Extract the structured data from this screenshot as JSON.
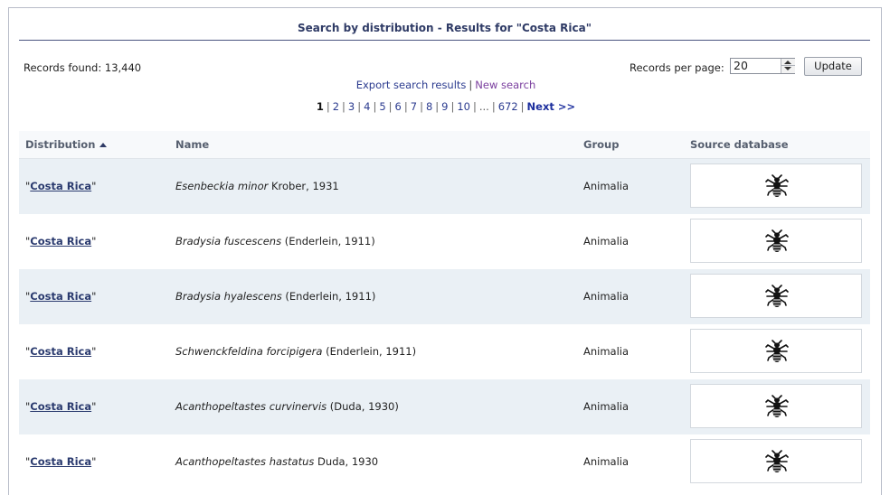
{
  "header": {
    "title": "Search by distribution - Results for \"Costa Rica\""
  },
  "toolbar": {
    "records_found": "Records found: 13,440",
    "records_per_page_label": "Records per page:",
    "records_per_page_value": "20",
    "update_label": "Update",
    "export_label": "Export search results",
    "separator": "|",
    "new_search_label": "New search"
  },
  "pagination": {
    "current": "1",
    "pages": [
      "2",
      "3",
      "4",
      "5",
      "6",
      "7",
      "8",
      "9",
      "10"
    ],
    "ellipsis": "...",
    "last": "672",
    "next_label": "Next >>"
  },
  "table": {
    "columns": {
      "distribution": "Distribution",
      "name": "Name",
      "group": "Group",
      "source": "Source database"
    },
    "sort_icon": "sort-ascending-icon",
    "rows": [
      {
        "distribution": "Costa Rica",
        "sci": "Esenbeckia minor",
        "author": " Krober, 1931",
        "group": "Animalia",
        "source_icon": "insect-icon"
      },
      {
        "distribution": "Costa Rica",
        "sci": "Bradysia fuscescens",
        "author": " (Enderlein, 1911)",
        "group": "Animalia",
        "source_icon": "insect-icon"
      },
      {
        "distribution": "Costa Rica",
        "sci": "Bradysia hyalescens",
        "author": " (Enderlein, 1911)",
        "group": "Animalia",
        "source_icon": "insect-icon"
      },
      {
        "distribution": "Costa Rica",
        "sci": "Schwenckfeldina forcipigera",
        "author": " (Enderlein, 1911)",
        "group": "Animalia",
        "source_icon": "insect-icon"
      },
      {
        "distribution": "Costa Rica",
        "sci": "Acanthopeltastes curvinervis",
        "author": " (Duda, 1930)",
        "group": "Animalia",
        "source_icon": "insect-icon"
      },
      {
        "distribution": "Costa Rica",
        "sci": "Acanthopeltastes hastatus",
        "author": " Duda, 1930",
        "group": "Animalia",
        "source_icon": "insect-icon"
      }
    ]
  }
}
